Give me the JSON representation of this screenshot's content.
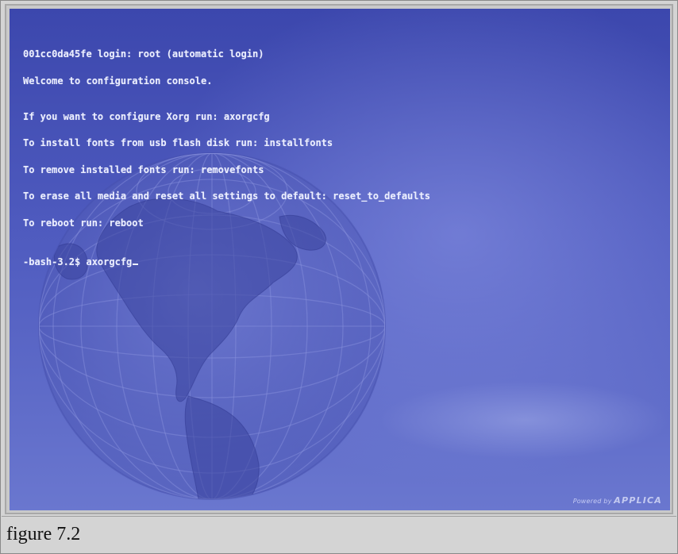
{
  "console": {
    "lines": [
      "001cc0da45fe login: root (automatic login)",
      "Welcome to configuration console.",
      "If you want to configure Xorg run: axorgcfg",
      "To install fonts from usb flash disk run: installfonts",
      "To remove installed fonts run: removefonts",
      "To erase all media and reset all settings to default: reset_to_defaults",
      "To reboot run: reboot"
    ],
    "prompt": "-bash-3.2$ axorgcfg"
  },
  "branding": {
    "powered_by": "Powered by",
    "brand_name": "APPLICA"
  },
  "caption": {
    "text": "figure 7.2"
  },
  "colors": {
    "screen_top": "#3c47ad",
    "screen_bottom": "#6a77cf",
    "console_text": "#ecefff",
    "caption_bg": "#d4d4d4"
  }
}
